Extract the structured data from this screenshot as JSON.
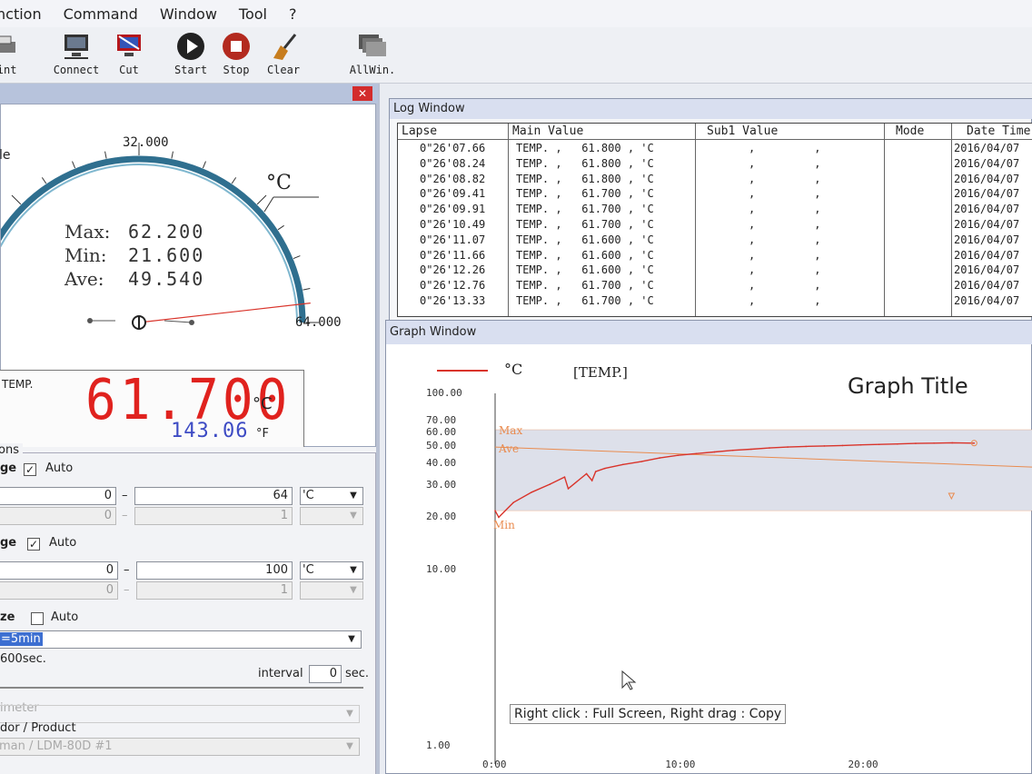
{
  "menu": [
    "nction",
    "Command",
    "Window",
    "Tool",
    "?"
  ],
  "toolbar": [
    {
      "id": "print",
      "label": "rint",
      "icon": "print-icon"
    },
    {
      "id": "connect",
      "label": "Connect",
      "icon": "connect-icon"
    },
    {
      "id": "cut",
      "label": "Cut",
      "icon": "cut-icon"
    },
    {
      "id": "start",
      "label": "Start",
      "icon": "start-icon"
    },
    {
      "id": "stop",
      "label": "Stop",
      "icon": "stop-icon"
    },
    {
      "id": "clear",
      "label": "Clear",
      "icon": "clear-icon"
    },
    {
      "id": "allwin",
      "label": "AllWin.",
      "icon": "allwin-icon"
    }
  ],
  "gauge": {
    "partial_label": "le",
    "scale_top": "32.000",
    "scale_max": "64.000",
    "unit": "°C",
    "max_label": "Max:",
    "max_value": "62.200",
    "min_label": "Min:",
    "min_value": "21.600",
    "ave_label": "Ave:",
    "ave_value": "49.540",
    "range": [
      0,
      64
    ],
    "current": 61.7
  },
  "digital": {
    "channel": "TEMP.",
    "value": "61.700",
    "unit": "°C",
    "sub_value": "143.06",
    "sub_unit": "°F"
  },
  "conditions": {
    "section_label": "ons",
    "y1": {
      "label": "ge",
      "auto_label": "Auto",
      "auto_checked": true,
      "row1_low": "0",
      "row1_high": "64",
      "row1_unit": "'C",
      "row2_low": "0",
      "row2_high": "1"
    },
    "y2": {
      "label": "ge",
      "auto_label": "Auto",
      "auto_checked": true,
      "row1_low": "0",
      "row1_high": "100",
      "row1_unit": "'C",
      "row2_low": "0",
      "row2_high": "1"
    },
    "time": {
      "label": "ze",
      "auto_label": "Auto",
      "auto_checked": false,
      "selected": "=5min",
      "span": "600sec.",
      "interval_label": "interval",
      "interval_value": "0",
      "interval_unit": "sec."
    },
    "device_label": "imeter",
    "vendor_label": "dor / Product",
    "vendor_value": "man / LDM-80D #1"
  },
  "log": {
    "title": "Log Window",
    "headers": [
      "Lapse",
      "Main Value",
      "Sub1 Value",
      "Mode",
      "Date Time"
    ],
    "rows": [
      {
        "lapse": "0\"26'07.66",
        "main": "TEMP. ,   61.800 , 'C",
        "sub": ",         ,",
        "date": "2016/04/07"
      },
      {
        "lapse": "0\"26'08.24",
        "main": "TEMP. ,   61.800 , 'C",
        "sub": ",         ,",
        "date": "2016/04/07"
      },
      {
        "lapse": "0\"26'08.82",
        "main": "TEMP. ,   61.800 , 'C",
        "sub": ",         ,",
        "date": "2016/04/07"
      },
      {
        "lapse": "0\"26'09.41",
        "main": "TEMP. ,   61.700 , 'C",
        "sub": ",         ,",
        "date": "2016/04/07"
      },
      {
        "lapse": "0\"26'09.91",
        "main": "TEMP. ,   61.700 , 'C",
        "sub": ",         ,",
        "date": "2016/04/07"
      },
      {
        "lapse": "0\"26'10.49",
        "main": "TEMP. ,   61.700 , 'C",
        "sub": ",         ,",
        "date": "2016/04/07"
      },
      {
        "lapse": "0\"26'11.07",
        "main": "TEMP. ,   61.600 , 'C",
        "sub": ",         ,",
        "date": "2016/04/07"
      },
      {
        "lapse": "0\"26'11.66",
        "main": "TEMP. ,   61.600 , 'C",
        "sub": ",         ,",
        "date": "2016/04/07"
      },
      {
        "lapse": "0\"26'12.26",
        "main": "TEMP. ,   61.600 , 'C",
        "sub": ",         ,",
        "date": "2016/04/07"
      },
      {
        "lapse": "0\"26'12.76",
        "main": "TEMP. ,   61.700 , 'C",
        "sub": ",         ,",
        "date": "2016/04/07"
      },
      {
        "lapse": "0\"26'13.33",
        "main": "TEMP. ,   61.700 , 'C",
        "sub": ",         ,",
        "date": "2016/04/07"
      }
    ]
  },
  "graph": {
    "window_title": "Graph Window",
    "unit": "°C",
    "channel": "[TEMP.]",
    "title": "Graph Title",
    "hint": "Right click : Full Screen,  Right drag : Copy",
    "max_label": "Max",
    "ave_label": "Ave",
    "min_label": "Min",
    "colors": {
      "series": "#d9342b",
      "limits": "#e98b4f",
      "band": "#dde0ea"
    }
  },
  "chart_data": {
    "type": "line",
    "title": "Graph Title",
    "ylabel": "°C",
    "yscale": "log",
    "ylim": [
      1,
      100
    ],
    "yticks": [
      "100.00",
      "70.00",
      "60.00",
      "50.00",
      "40.00",
      "30.00",
      "20.00",
      "10.00",
      "1.00"
    ],
    "xticks": [
      "0:00",
      "10:00",
      "20:00"
    ],
    "series": [
      {
        "name": "[TEMP.]",
        "x": [
          0,
          0.2,
          1,
          2,
          3,
          3.8,
          4,
          5,
          5.3,
          5.5,
          6,
          7,
          8,
          9,
          10,
          11,
          12,
          13,
          14,
          15,
          16,
          17,
          18,
          19,
          20,
          21,
          22,
          23,
          24,
          25,
          26.2
        ],
        "values": [
          21.6,
          19.8,
          24,
          27.5,
          30.5,
          33.5,
          28.8,
          35,
          32,
          36,
          37.5,
          39.5,
          41,
          43,
          44.5,
          45.5,
          46.5,
          47.5,
          48.2,
          49,
          49.6,
          50,
          50.3,
          50.6,
          51,
          51.3,
          51.6,
          52,
          52.2,
          52.4,
          52.2
        ]
      }
    ],
    "lines": {
      "max": 62.2,
      "ave": 49.54,
      "min": 21.6
    }
  }
}
